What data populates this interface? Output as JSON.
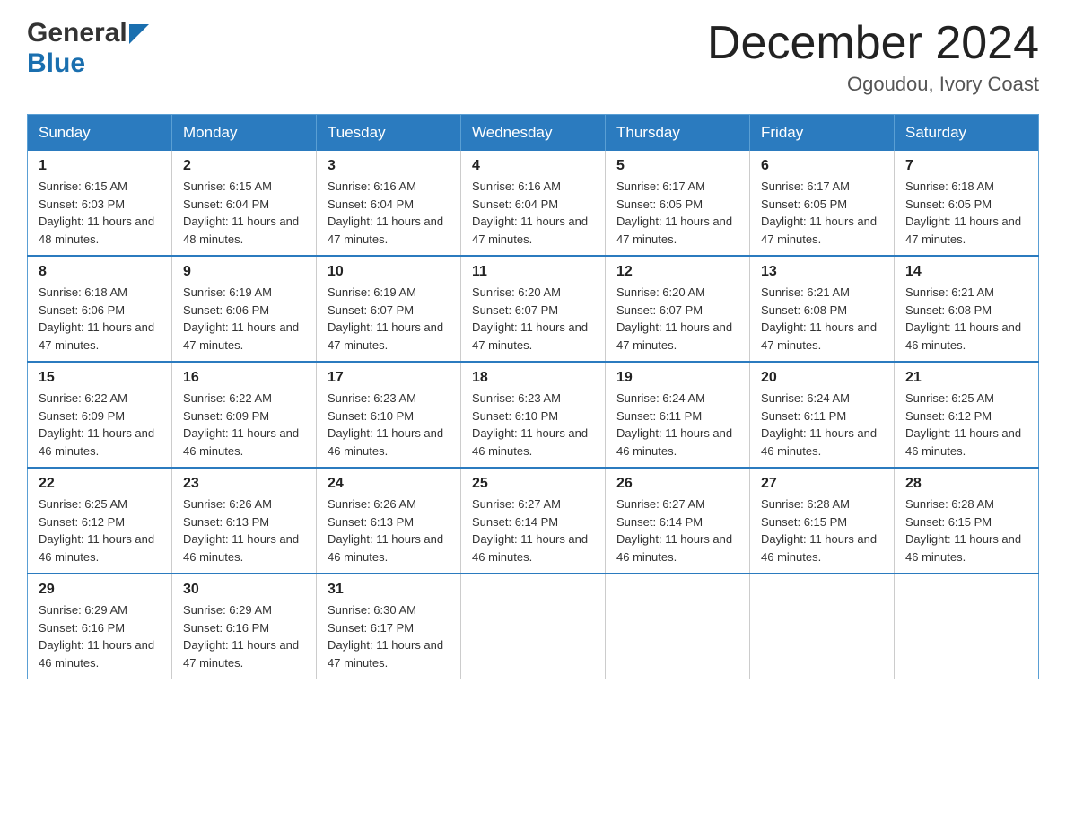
{
  "header": {
    "logo_general": "General",
    "logo_blue": "Blue",
    "month_title": "December 2024",
    "location": "Ogoudou, Ivory Coast"
  },
  "calendar": {
    "days_of_week": [
      "Sunday",
      "Monday",
      "Tuesday",
      "Wednesday",
      "Thursday",
      "Friday",
      "Saturday"
    ],
    "weeks": [
      [
        {
          "day": "1",
          "sunrise": "6:15 AM",
          "sunset": "6:03 PM",
          "daylight": "11 hours and 48 minutes."
        },
        {
          "day": "2",
          "sunrise": "6:15 AM",
          "sunset": "6:04 PM",
          "daylight": "11 hours and 48 minutes."
        },
        {
          "day": "3",
          "sunrise": "6:16 AM",
          "sunset": "6:04 PM",
          "daylight": "11 hours and 47 minutes."
        },
        {
          "day": "4",
          "sunrise": "6:16 AM",
          "sunset": "6:04 PM",
          "daylight": "11 hours and 47 minutes."
        },
        {
          "day": "5",
          "sunrise": "6:17 AM",
          "sunset": "6:05 PM",
          "daylight": "11 hours and 47 minutes."
        },
        {
          "day": "6",
          "sunrise": "6:17 AM",
          "sunset": "6:05 PM",
          "daylight": "11 hours and 47 minutes."
        },
        {
          "day": "7",
          "sunrise": "6:18 AM",
          "sunset": "6:05 PM",
          "daylight": "11 hours and 47 minutes."
        }
      ],
      [
        {
          "day": "8",
          "sunrise": "6:18 AM",
          "sunset": "6:06 PM",
          "daylight": "11 hours and 47 minutes."
        },
        {
          "day": "9",
          "sunrise": "6:19 AM",
          "sunset": "6:06 PM",
          "daylight": "11 hours and 47 minutes."
        },
        {
          "day": "10",
          "sunrise": "6:19 AM",
          "sunset": "6:07 PM",
          "daylight": "11 hours and 47 minutes."
        },
        {
          "day": "11",
          "sunrise": "6:20 AM",
          "sunset": "6:07 PM",
          "daylight": "11 hours and 47 minutes."
        },
        {
          "day": "12",
          "sunrise": "6:20 AM",
          "sunset": "6:07 PM",
          "daylight": "11 hours and 47 minutes."
        },
        {
          "day": "13",
          "sunrise": "6:21 AM",
          "sunset": "6:08 PM",
          "daylight": "11 hours and 47 minutes."
        },
        {
          "day": "14",
          "sunrise": "6:21 AM",
          "sunset": "6:08 PM",
          "daylight": "11 hours and 46 minutes."
        }
      ],
      [
        {
          "day": "15",
          "sunrise": "6:22 AM",
          "sunset": "6:09 PM",
          "daylight": "11 hours and 46 minutes."
        },
        {
          "day": "16",
          "sunrise": "6:22 AM",
          "sunset": "6:09 PM",
          "daylight": "11 hours and 46 minutes."
        },
        {
          "day": "17",
          "sunrise": "6:23 AM",
          "sunset": "6:10 PM",
          "daylight": "11 hours and 46 minutes."
        },
        {
          "day": "18",
          "sunrise": "6:23 AM",
          "sunset": "6:10 PM",
          "daylight": "11 hours and 46 minutes."
        },
        {
          "day": "19",
          "sunrise": "6:24 AM",
          "sunset": "6:11 PM",
          "daylight": "11 hours and 46 minutes."
        },
        {
          "day": "20",
          "sunrise": "6:24 AM",
          "sunset": "6:11 PM",
          "daylight": "11 hours and 46 minutes."
        },
        {
          "day": "21",
          "sunrise": "6:25 AM",
          "sunset": "6:12 PM",
          "daylight": "11 hours and 46 minutes."
        }
      ],
      [
        {
          "day": "22",
          "sunrise": "6:25 AM",
          "sunset": "6:12 PM",
          "daylight": "11 hours and 46 minutes."
        },
        {
          "day": "23",
          "sunrise": "6:26 AM",
          "sunset": "6:13 PM",
          "daylight": "11 hours and 46 minutes."
        },
        {
          "day": "24",
          "sunrise": "6:26 AM",
          "sunset": "6:13 PM",
          "daylight": "11 hours and 46 minutes."
        },
        {
          "day": "25",
          "sunrise": "6:27 AM",
          "sunset": "6:14 PM",
          "daylight": "11 hours and 46 minutes."
        },
        {
          "day": "26",
          "sunrise": "6:27 AM",
          "sunset": "6:14 PM",
          "daylight": "11 hours and 46 minutes."
        },
        {
          "day": "27",
          "sunrise": "6:28 AM",
          "sunset": "6:15 PM",
          "daylight": "11 hours and 46 minutes."
        },
        {
          "day": "28",
          "sunrise": "6:28 AM",
          "sunset": "6:15 PM",
          "daylight": "11 hours and 46 minutes."
        }
      ],
      [
        {
          "day": "29",
          "sunrise": "6:29 AM",
          "sunset": "6:16 PM",
          "daylight": "11 hours and 46 minutes."
        },
        {
          "day": "30",
          "sunrise": "6:29 AM",
          "sunset": "6:16 PM",
          "daylight": "11 hours and 47 minutes."
        },
        {
          "day": "31",
          "sunrise": "6:30 AM",
          "sunset": "6:17 PM",
          "daylight": "11 hours and 47 minutes."
        },
        null,
        null,
        null,
        null
      ]
    ],
    "labels": {
      "sunrise": "Sunrise: ",
      "sunset": "Sunset: ",
      "daylight": "Daylight: "
    }
  }
}
